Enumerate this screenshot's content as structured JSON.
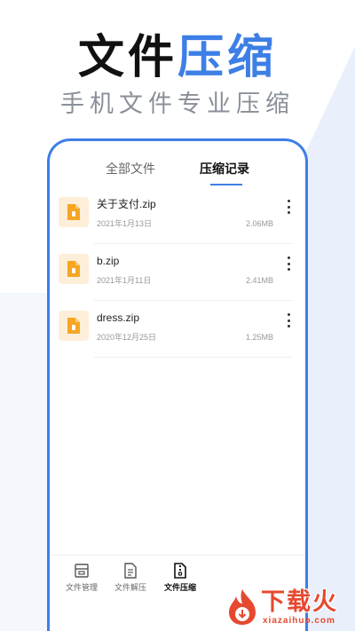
{
  "headline": {
    "dark": "文件",
    "blue": "压缩"
  },
  "subline": "手机文件专业压缩",
  "tabs": [
    {
      "label": "全部文件",
      "active": false
    },
    {
      "label": "压缩记录",
      "active": true
    }
  ],
  "files": [
    {
      "name": "关于支付.zip",
      "date": "2021年1月13日",
      "size": "2.06MB",
      "icon": "zip-file-icon"
    },
    {
      "name": "b.zip",
      "date": "2021年1月11日",
      "size": "2.41MB",
      "icon": "zip-file-icon"
    },
    {
      "name": "dress.zip",
      "date": "2020年12月25日",
      "size": "1.25MB",
      "icon": "zip-file-icon"
    }
  ],
  "bottom_nav": [
    {
      "label": "文件管理",
      "icon": "file-manage-icon",
      "active": false
    },
    {
      "label": "文件解压",
      "icon": "file-extract-icon",
      "active": false
    },
    {
      "label": "文件压缩",
      "icon": "file-compress-icon",
      "active": true
    }
  ],
  "watermark": {
    "text": "下载火",
    "sub": "xiazaihuo.com"
  },
  "colors": {
    "accent": "#3d7fe6",
    "file_icon_bg": "#fdeed9",
    "file_icon": "#f5a623",
    "watermark": "#e6492f"
  }
}
